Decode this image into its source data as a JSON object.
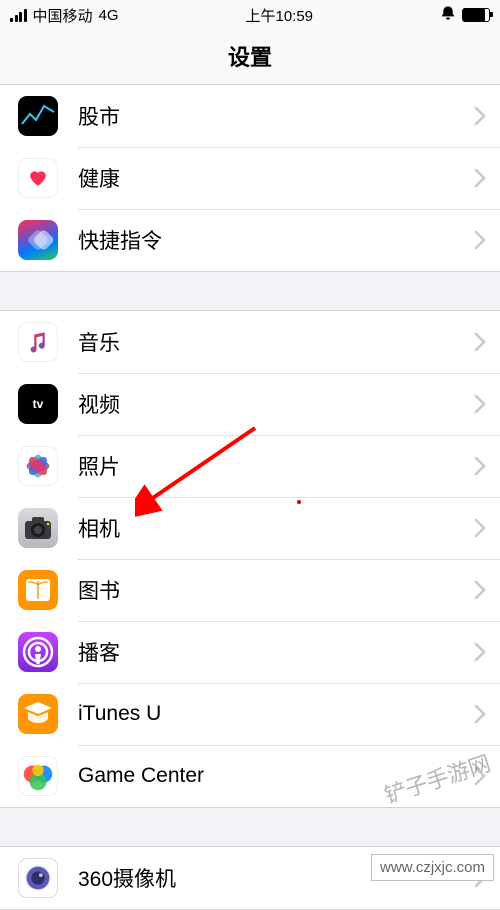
{
  "status": {
    "carrier": "中国移动",
    "network": "4G",
    "time": "上午10:59"
  },
  "header": {
    "title": "设置"
  },
  "groups": [
    {
      "items": [
        {
          "id": "stocks",
          "label": "股市"
        },
        {
          "id": "health",
          "label": "健康"
        },
        {
          "id": "shortcuts",
          "label": "快捷指令"
        }
      ]
    },
    {
      "items": [
        {
          "id": "music",
          "label": "音乐"
        },
        {
          "id": "video",
          "label": "视频"
        },
        {
          "id": "photos",
          "label": "照片"
        },
        {
          "id": "camera",
          "label": "相机"
        },
        {
          "id": "books",
          "label": "图书"
        },
        {
          "id": "podcast",
          "label": "播客"
        },
        {
          "id": "itunesu",
          "label": "iTunes U"
        },
        {
          "id": "gamecenter",
          "label": "Game Center"
        }
      ]
    },
    {
      "items": [
        {
          "id": "360cam",
          "label": "360摄像机"
        }
      ]
    }
  ],
  "icons": {
    "video_text_top": "tv",
    "video_apple": ""
  },
  "annotation": {
    "arrow_target": "camera",
    "arrow_color": "#ff0000"
  },
  "watermarks": {
    "diagonal": "铲子手游网",
    "box": "www.czjxjc.com"
  }
}
